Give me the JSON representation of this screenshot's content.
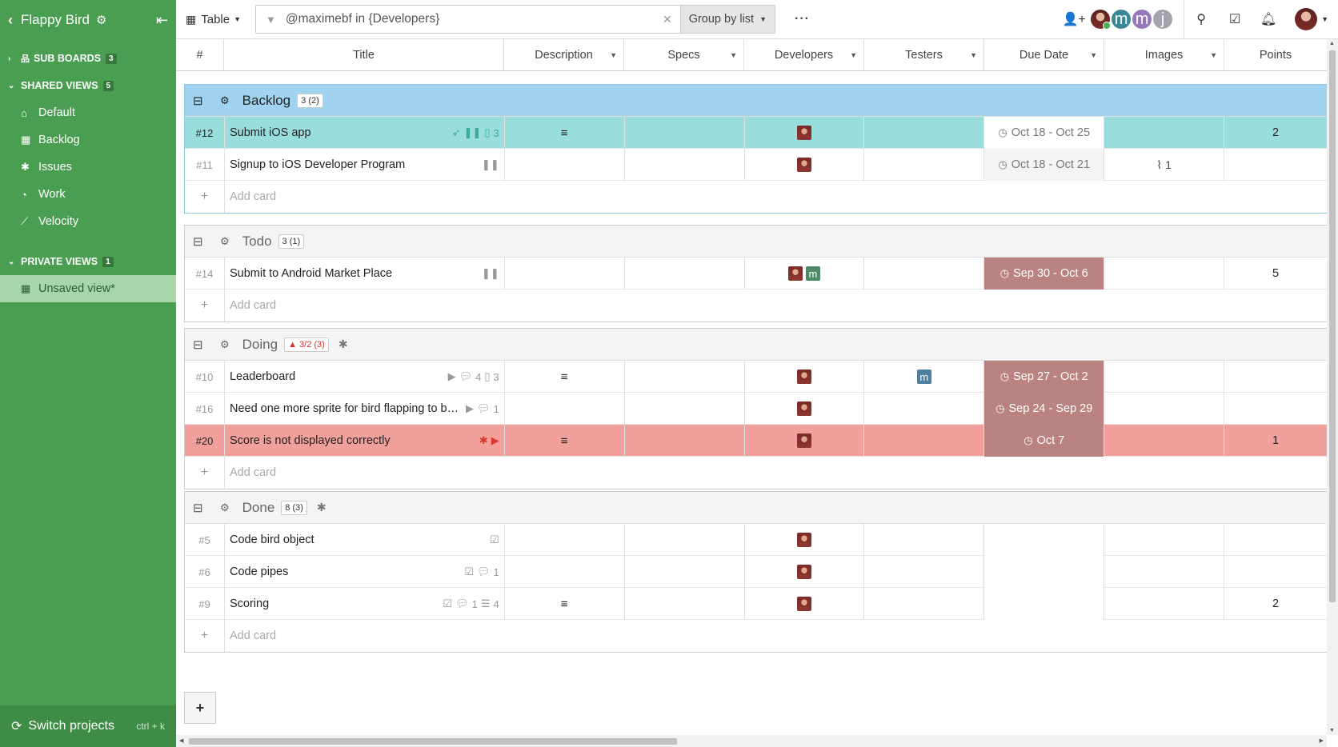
{
  "sidebar": {
    "project_name": "Flappy Bird",
    "sections": [
      {
        "label": "SUB BOARDS",
        "count": "3",
        "icon": "sitemap-icon"
      },
      {
        "label": "SHARED VIEWS",
        "count": "5"
      },
      {
        "label": "PRIVATE VIEWS",
        "count": "1"
      }
    ],
    "shared_views": [
      {
        "label": "Default",
        "icon": "home-icon"
      },
      {
        "label": "Backlog",
        "icon": "grid-icon"
      },
      {
        "label": "Issues",
        "icon": "bug-icon"
      },
      {
        "label": "Work",
        "icon": "dashboard-icon"
      },
      {
        "label": "Velocity",
        "icon": "chart-icon"
      }
    ],
    "private_views": [
      {
        "label": "Unsaved view*",
        "icon": "grid-icon",
        "active": true
      }
    ],
    "footer": {
      "label": "Switch projects",
      "shortcut": "ctrl + k"
    },
    "bg_color": "#4a9e52"
  },
  "topbar": {
    "view_type": "Table",
    "filter_value": "@maximebf in {Developers}",
    "group_by": "Group by list",
    "more": "···",
    "team": [
      "m",
      "m",
      "j"
    ]
  },
  "columns": [
    "#",
    "Title",
    "Description",
    "Specs",
    "Developers",
    "Testers",
    "Due Date",
    "Images",
    "Points"
  ],
  "groups": [
    {
      "name": "Backlog",
      "count": "3 (2)",
      "rows": [
        {
          "num": "#12",
          "title": "Submit iOS app",
          "badges": [
            "rocket-icon",
            "pause-icon",
            "book-icon:3"
          ],
          "desc": "≡",
          "due": "Oct 18 - Oct 25",
          "images": "",
          "points": "2"
        },
        {
          "num": "#11",
          "title": "Signup to iOS Developer Program",
          "badges": [
            "pause-icon"
          ],
          "desc": "",
          "due": "Oct 18 - Oct 21",
          "images": "1",
          "points": ""
        }
      ],
      "add_label": "Add card"
    },
    {
      "name": "Todo",
      "count": "3 (1)",
      "rows": [
        {
          "num": "#14",
          "title": "Submit to Android Market Place",
          "badges": [
            "pause-icon"
          ],
          "desc": "",
          "due": "Sep 30 - Oct 6",
          "images": "",
          "points": "5",
          "extra_dev": "m"
        }
      ],
      "add_label": "Add card"
    },
    {
      "name": "Doing",
      "count": "3/2 (3)",
      "rows": [
        {
          "num": "#10",
          "title": "Leaderboard",
          "badges": [
            "play-icon",
            "comment-icon:4",
            "book-icon:3"
          ],
          "desc": "≡",
          "due": "Sep 27 - Oct 2",
          "tester": "m",
          "points": ""
        },
        {
          "num": "#16",
          "title": "Need one more sprite for bird flapping to be …",
          "badges": [
            "play-icon",
            "comment-icon:1"
          ],
          "desc": "",
          "due": "Sep 24 - Sep 29",
          "points": ""
        },
        {
          "num": "#20",
          "title": "Score is not displayed correctly",
          "badges": [
            "bug-icon",
            "play-icon"
          ],
          "desc": "≡",
          "due": "Oct 7",
          "points": "1"
        }
      ],
      "add_label": "Add card"
    },
    {
      "name": "Done",
      "count": "8 (3)",
      "rows": [
        {
          "num": "#5",
          "title": "Code bird object",
          "badges": [
            "check-icon"
          ],
          "desc": "",
          "due": "",
          "points": ""
        },
        {
          "num": "#6",
          "title": "Code pipes",
          "badges": [
            "check-icon",
            "comment-icon:1"
          ],
          "desc": "",
          "due": "",
          "points": ""
        },
        {
          "num": "#9",
          "title": "Scoring",
          "badges": [
            "check-icon",
            "comment-icon:1",
            "list-icon:4"
          ],
          "desc": "≡",
          "due": "",
          "points": "2"
        }
      ],
      "add_label": "Add card"
    }
  ],
  "badge_counts": {
    "b12_book": "3",
    "b10_comment": "4",
    "b10_book": "3",
    "b16_comment": "1",
    "b6_comment": "1",
    "b9_comment": "1",
    "b9_list": "4"
  },
  "colors": {
    "accent_green": "#4a9e52",
    "selected_row": "#99dedd",
    "bug_row": "#f1a09b",
    "late_due": "#ba8381",
    "active_group_header": "#a0d3ef"
  }
}
